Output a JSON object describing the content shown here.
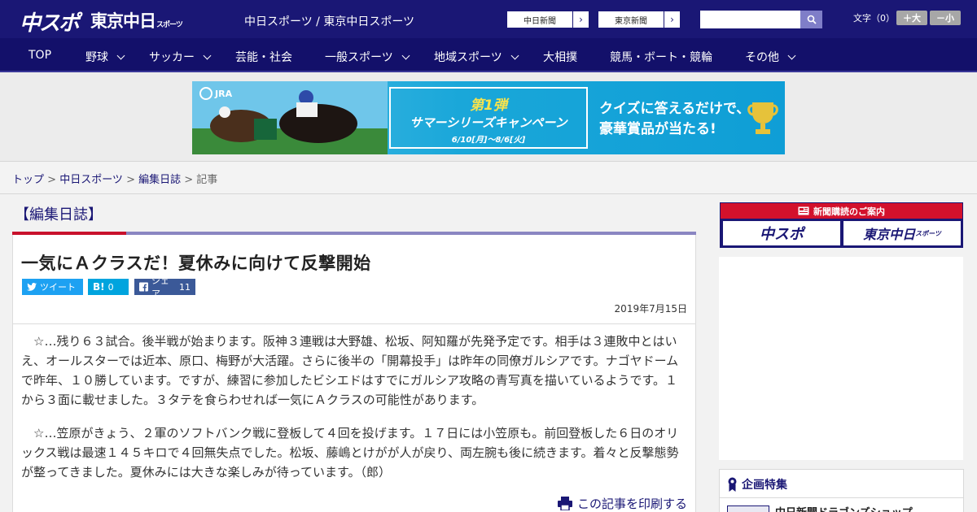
{
  "header": {
    "logo_main": "中スポ",
    "logo_tokyo": "東京中日",
    "logo_tokyo_suffix": "スポーツ",
    "site_links": "中日スポーツ / 東京中日スポーツ",
    "chunichi_link": "中日新聞",
    "tokyo_link": "東京新聞",
    "search_placeholder": "",
    "moji_label": "文字（0）",
    "moji_plus": "＋大",
    "moji_minus": "－小"
  },
  "nav": {
    "items": [
      {
        "label": "TOP",
        "dropdown": false
      },
      {
        "label": "野球",
        "dropdown": true
      },
      {
        "label": "サッカー",
        "dropdown": true
      },
      {
        "label": "芸能・社会",
        "dropdown": false
      },
      {
        "label": "一般スポーツ",
        "dropdown": true
      },
      {
        "label": "地域スポーツ",
        "dropdown": true
      },
      {
        "label": "大相撲",
        "dropdown": false
      },
      {
        "label": "競馬・ボート・競輪",
        "dropdown": false
      },
      {
        "label": "その他",
        "dropdown": true
      }
    ]
  },
  "banner": {
    "jra": "JRA",
    "campaign_line1": "第1弾",
    "campaign_line2": "サマーシリーズキャンペーン",
    "campaign_dates": "6/10[月]～8/6[火]",
    "quiz_line1": "クイズに答えるだけで、",
    "quiz_line2": "豪華賞品が当たる!"
  },
  "breadcrumb": {
    "top": "トップ",
    "sep": " > ",
    "chunichi": "中日スポーツ",
    "diary": "編集日誌",
    "current": "記事"
  },
  "section": {
    "title": "【編集日誌】"
  },
  "article": {
    "headline": "一気にＡクラスだ！夏休みに向けて反撃開始",
    "share_twitter": "ツイート",
    "share_hatena_icon": "B!",
    "share_hatena_count": "0",
    "share_fb": "シェア",
    "share_fb_count": "11",
    "date": "2019年7月15日",
    "paragraph1": "　☆…残り６３試合。後半戦が始まります。阪神３連戦は大野雄、松坂、阿知羅が先発予定です。相手は３連敗中とはいえ、オールスターでは近本、原口、梅野が大活躍。さらに後半の「開幕投手」は昨年の同僚ガルシアです。ナゴヤドームで昨年、１０勝しています。ですが、練習に参加したビシエドはすでにガルシア攻略の青写真を描いているようです。１から３面に載せました。３タテを食らわせれば一気にＡクラスの可能性があります。",
    "paragraph2": "　☆…笠原がきょう、２軍のソフトバンク戦に登板して４回を投げます。１７日には小笠原も。前回登板した６日のオリックス戦は最速１４５キロで４回無失点でした。松坂、藤嶋とけがが人が戻り、両左腕も後に続きます。着々と反撃態勢が整ってきました。夏休みには大きな楽しみが待っています。（郎）",
    "print_label": "この記事を印刷する"
  },
  "sidebar": {
    "subscribe_head": "新聞購読のご案内",
    "subscribe_chuspo": "中スポ",
    "subscribe_tokyo": "東京中日",
    "subscribe_tokyo_suffix": "スポーツ",
    "feature_head": "企画特集",
    "feature_item": "中日新聞ドラゴンズショップ"
  },
  "colors": {
    "brand": "#1a1775",
    "accent_red": "#c8112c",
    "twitter": "#1da1f2",
    "hatena": "#00a4de",
    "facebook": "#3b5998"
  }
}
